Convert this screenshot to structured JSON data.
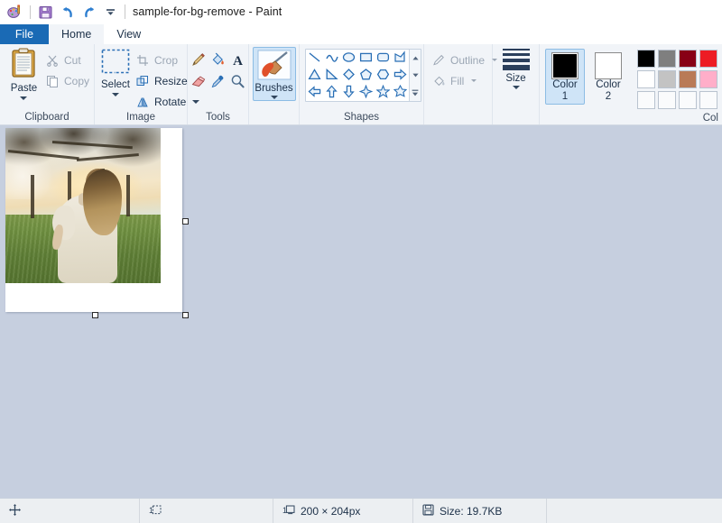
{
  "window": {
    "title": "sample-for-bg-remove - Paint",
    "quick_access": [
      {
        "name": "paint-app-icon",
        "label": "Paint"
      },
      {
        "name": "save-icon",
        "label": "Save"
      },
      {
        "name": "undo-icon",
        "label": "Undo"
      },
      {
        "name": "redo-icon",
        "label": "Redo"
      },
      {
        "name": "customize-quick-access-icon",
        "label": "Customize Quick Access Toolbar"
      }
    ]
  },
  "tabs": [
    {
      "label": "File",
      "state": "file"
    },
    {
      "label": "Home",
      "state": "active"
    },
    {
      "label": "View",
      "state": "normal"
    }
  ],
  "ribbon": {
    "groups": [
      {
        "name": "clipboard",
        "label": "Clipboard",
        "paste": {
          "label": "Paste",
          "icon": "clipboard-icon",
          "enabled": true
        },
        "items": [
          {
            "label": "Cut",
            "icon": "scissors-icon",
            "enabled": false
          },
          {
            "label": "Copy",
            "icon": "copy-icon",
            "enabled": false
          }
        ]
      },
      {
        "name": "image",
        "label": "Image",
        "select": {
          "label": "Select",
          "icon": "selection-marquee-icon",
          "enabled": true
        },
        "items": [
          {
            "label": "Crop",
            "icon": "crop-icon",
            "enabled": false
          },
          {
            "label": "Resize",
            "icon": "resize-icon",
            "enabled": true
          },
          {
            "label": "Rotate",
            "icon": "rotate-icon",
            "enabled": true
          }
        ]
      },
      {
        "name": "tools",
        "label": "Tools",
        "items": [
          {
            "label": "Pencil",
            "icon": "pencil-icon"
          },
          {
            "label": "Fill with color",
            "icon": "paint-bucket-icon"
          },
          {
            "label": "Text",
            "icon": "text-a-icon"
          },
          {
            "label": "Eraser",
            "icon": "eraser-icon"
          },
          {
            "label": "Color picker",
            "icon": "eyedropper-icon"
          },
          {
            "label": "Magnifier",
            "icon": "magnifier-icon"
          }
        ]
      },
      {
        "name": "brushes",
        "label": "",
        "brushes": {
          "label": "Brushes",
          "icon": "paintbrush-icon",
          "selected": true
        }
      },
      {
        "name": "shapes",
        "label": "Shapes",
        "items": [
          {
            "label": "Line",
            "icon": "shape-line-icon"
          },
          {
            "label": "Curve",
            "icon": "shape-curve-icon"
          },
          {
            "label": "Oval",
            "icon": "shape-oval-icon"
          },
          {
            "label": "Rectangle",
            "icon": "shape-rectangle-icon"
          },
          {
            "label": "Rounded rectangle",
            "icon": "shape-rounded-rectangle-icon"
          },
          {
            "label": "Polygon",
            "icon": "shape-polygon-icon"
          },
          {
            "label": "Triangle",
            "icon": "shape-triangle-icon"
          },
          {
            "label": "Right triangle",
            "icon": "shape-right-triangle-icon"
          },
          {
            "label": "Diamond",
            "icon": "shape-diamond-icon"
          },
          {
            "label": "Pentagon",
            "icon": "shape-pentagon-icon"
          },
          {
            "label": "Hexagon",
            "icon": "shape-hexagon-icon"
          },
          {
            "label": "Right arrow",
            "icon": "shape-right-arrow-icon"
          },
          {
            "label": "Left arrow",
            "icon": "shape-left-arrow-icon"
          },
          {
            "label": "Up arrow",
            "icon": "shape-up-arrow-icon"
          },
          {
            "label": "Down arrow",
            "icon": "shape-down-arrow-icon"
          },
          {
            "label": "Four-point star",
            "icon": "shape-four-point-star-icon"
          },
          {
            "label": "Five-point star",
            "icon": "shape-five-point-star-icon"
          },
          {
            "label": "Six-point star",
            "icon": "shape-six-point-star-icon"
          }
        ],
        "scroll": [
          {
            "label": "Scroll up",
            "icon": "scroll-up-icon"
          },
          {
            "label": "Scroll down",
            "icon": "scroll-down-icon"
          },
          {
            "label": "Expand gallery",
            "icon": "expand-gallery-icon"
          }
        ]
      },
      {
        "name": "outline-fill",
        "label": "",
        "items": [
          {
            "label": "Outline",
            "icon": "outline-pen-icon",
            "enabled": false
          },
          {
            "label": "Fill",
            "icon": "fill-bucket-icon",
            "enabled": false
          }
        ]
      },
      {
        "name": "size",
        "label": "",
        "size": {
          "label": "Size",
          "icon": "line-size-icon"
        }
      },
      {
        "name": "colors",
        "label": "Col",
        "color1": {
          "label_top": "Color",
          "label_bottom": "1",
          "value": "#000000",
          "selected": true
        },
        "color2": {
          "label_top": "Color",
          "label_bottom": "2",
          "value": "#ffffff",
          "selected": false
        },
        "palette": [
          "#000000",
          "#7f7f7f",
          "#880015",
          "#ed1c24",
          "#ffffff",
          "#c3c3c3",
          "#b97a57",
          "#ffaec9",
          "#fafbfc",
          "#fafbfc",
          "#fafbfc",
          "#fafbfc"
        ]
      }
    ]
  },
  "canvas": {
    "background_color": "#c6cfdf",
    "sheet_color": "#ffffff",
    "image_alt": "Woman in cream dress with long blonde hair standing in a grassy field with blossoming trees at sunset",
    "handles": [
      "resize-handle-right",
      "resize-handle-bottom",
      "resize-handle-corner"
    ]
  },
  "statusbar": {
    "cursor_position": {
      "icon": "cursor-position-icon",
      "value": ""
    },
    "selection_size": {
      "icon": "selection-size-icon",
      "value": ""
    },
    "image_dimensions": {
      "icon": "image-size-icon",
      "value": "200 × 204px"
    },
    "file_size": {
      "icon": "disk-icon",
      "value": "Size: 19.7KB"
    }
  }
}
